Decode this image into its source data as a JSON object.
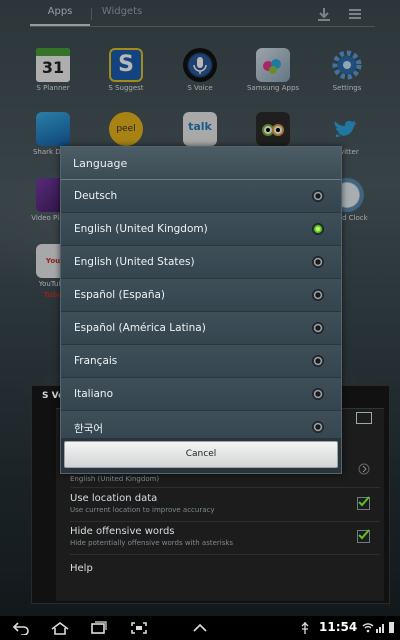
{
  "top_tabs": {
    "apps": "Apps",
    "widgets": "Widgets"
  },
  "apps_row1": [
    {
      "label": "S Planner",
      "icon": "calendar-icon",
      "day": "31"
    },
    {
      "label": "S Suggest",
      "icon": "s-suggest-icon",
      "letter": "S"
    },
    {
      "label": "S Voice",
      "icon": "microphone-icon"
    },
    {
      "label": "Samsung Apps",
      "icon": "samsung-apps-icon"
    },
    {
      "label": "Settings",
      "icon": "gear-icon"
    }
  ],
  "apps_row2": [
    {
      "label": "Shark Dash",
      "icon": "shark-icon"
    },
    {
      "label": "",
      "icon": "peel-icon",
      "text": "peel"
    },
    {
      "label": "",
      "icon": "talk-icon",
      "text": "talk"
    },
    {
      "label": "",
      "icon": "tripadvisor-icon"
    },
    {
      "label": "Twitter",
      "icon": "twitter-icon"
    }
  ],
  "apps_row3_edges": [
    {
      "label": "Video Player",
      "icon": "video-icon"
    },
    {
      "label": "World Clock",
      "icon": "world-clock-icon"
    }
  ],
  "apps_row4_edges": [
    {
      "label": "YouTube",
      "icon": "youtube-icon",
      "text": "You Tube"
    }
  ],
  "svoice_panel": {
    "title": "S Vo",
    "sub_language": "English (United Kingdom)",
    "rows": [
      {
        "title": "Use location data",
        "subtitle": "Use current location to improve accuracy",
        "checked": true
      },
      {
        "title": "Hide offensive words",
        "subtitle": "Hide potentially offensive words with asterisks",
        "checked": true
      },
      {
        "title": "Help",
        "subtitle": ""
      }
    ]
  },
  "language_dialog": {
    "title": "Language",
    "options": [
      {
        "label": "Deutsch",
        "selected": false
      },
      {
        "label": "English (United Kingdom)",
        "selected": true
      },
      {
        "label": "English (United States)",
        "selected": false
      },
      {
        "label": "Español (España)",
        "selected": false
      },
      {
        "label": "Español (América Latina)",
        "selected": false
      },
      {
        "label": "Français",
        "selected": false
      },
      {
        "label": "Italiano",
        "selected": false
      },
      {
        "label": "한국어",
        "selected": false
      }
    ],
    "cancel_label": "Cancel"
  },
  "status_bar": {
    "time": "11:54"
  },
  "colors": {
    "accent_green": "#66cc22",
    "dialog_bg": "#3a4a52"
  }
}
